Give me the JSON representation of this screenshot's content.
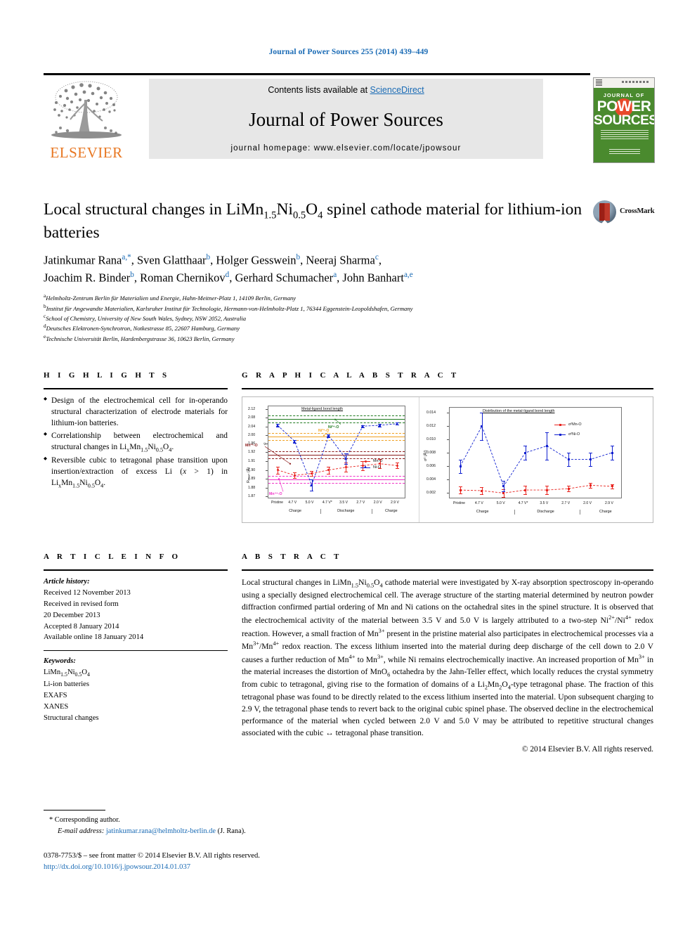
{
  "runhead": "Journal of Power Sources 255 (2014) 439–449",
  "masthead": {
    "contents_prefix": "Contents lists available at ",
    "sciencedirect": "ScienceDirect",
    "journal_title": "Journal of Power Sources",
    "homepage": "journal homepage: www.elsevier.com/locate/jpowsour",
    "publisher_wordmark": "ELSEVIER",
    "cover": {
      "line1": "JOURNAL OF",
      "line2": "POWER",
      "line3": "SOURCES"
    }
  },
  "article": {
    "title_part1": "Local structural changes in LiMn",
    "title_sub1": "1.5",
    "title_part2": "Ni",
    "title_sub2": "0.5",
    "title_part3": "O",
    "title_sub3": "4",
    "title_part4": " spinel cathode material for lithium-ion batteries",
    "crossmark_label": "CrossMark",
    "authors_line1": "Jatinkumar Rana a,*, Sven Glatthaar b, Holger Gesswein b, Neeraj Sharma c,",
    "authors_line2": "Joachim R. Binder b, Roman Chernikov d, Gerhard Schumacher a, John Banhart a,e",
    "affiliations": [
      {
        "mark": "a",
        "text": "Helmholtz-Zentrum Berlin für Materialien und Energie, Hahn-Meitner-Platz 1, 14109 Berlin, Germany"
      },
      {
        "mark": "b",
        "text": "Institut für Angewandte Materialien, Karlsruher Institut für Technologie, Hermann-von-Helmholtz-Platz 1, 76344 Eggenstein-Leopoldshafen, Germany"
      },
      {
        "mark": "c",
        "text": "School of Chemistry, University of New South Wales, Sydney, NSW 2052, Australia"
      },
      {
        "mark": "d",
        "text": "Deutsches Elektronen-Synchrotron, Notkestrasse 85, 22607 Hamburg, Germany"
      },
      {
        "mark": "e",
        "text": "Technische Universität Berlin, Hardenbergstrasse 36, 10623 Berlin, Germany"
      }
    ]
  },
  "highlights": {
    "heading": "H I G H L I G H T S",
    "items": [
      "Design of the electrochemical cell for in-operando structural characterization of electrode materials for lithium-ion batteries.",
      "Correlationship between electrochemical and structural changes in LixMn1.5Ni0.5O4.",
      "Reversible cubic to tetragonal phase transition upon insertion/extraction of excess Li (x > 1) in LixMn1.5Ni0.5O4."
    ]
  },
  "graphical_abstract": {
    "heading": "G R A P H I C A L   A B S T R A C T"
  },
  "article_info": {
    "heading": "A R T I C L E   I N F O",
    "history_label": "Article history:",
    "history": [
      "Received 12 November 2013",
      "Received in revised form",
      "20 December 2013",
      "Accepted 8 January 2014",
      "Available online 18 January 2014"
    ],
    "keywords_label": "Keywords:",
    "keywords": [
      "LiMn1.5Ni0.5O4",
      "Li-ion batteries",
      "EXAFS",
      "XANES",
      "Structural changes"
    ]
  },
  "abstract": {
    "heading": "A B S T R A C T",
    "body": "Local structural changes in LiMn1.5Ni0.5O4 cathode material were investigated by X-ray absorption spectroscopy in-operando using a specially designed electrochemical cell. The average structure of the starting material determined by neutron powder diffraction confirmed partial ordering of Mn and Ni cations on the octahedral sites in the spinel structure. It is observed that the electrochemical activity of the material between 3.5 V and 5.0 V is largely attributed to a two-step Ni2+/Ni4+ redox reaction. However, a small fraction of Mn3+ present in the pristine material also participates in electrochemical processes via a Mn3+/Mn4+ redox reaction. The excess lithium inserted into the material during deep discharge of the cell down to 2.0 V causes a further reduction of Mn4+ to Mn3+, while Ni remains electrochemically inactive. An increased proportion of Mn3+ in the material increases the distortion of MnO6 octahedra by the Jahn-Teller effect, which locally reduces the crystal symmetry from cubic to tetragonal, giving rise to the formation of domains of a Li2Mn2O4-type tetragonal phase. The fraction of this tetragonal phase was found to be directly related to the excess lithium inserted into the material. Upon subsequent charging to 2.9 V, the tetragonal phase tends to revert back to the original cubic spinel phase. The observed decline in the electrochemical performance of the material when cycled between 2.0 V and 5.0 V may be attributed to repetitive structural changes associated with the cubic ↔ tetragonal phase transition.",
    "copyright": "© 2014 Elsevier B.V. All rights reserved."
  },
  "footer": {
    "corresponding": "* Corresponding author.",
    "email_label": "E-mail address:",
    "email": "jatinkumar.rana@helmholtz-berlin.de",
    "email_suffix": "(J. Rana).",
    "issn_line": "0378-7753/$ – see front matter © 2014 Elsevier B.V. All rights reserved.",
    "doi": "http://dx.doi.org/10.1016/j.jpowsour.2014.01.037"
  },
  "chart_data": [
    {
      "id": "bond-length",
      "type": "line",
      "title": "Metal-ligand bond length",
      "ylabel": "R_mean (Å)",
      "xlabel": "",
      "categories": [
        "Pristine",
        "4.7 V",
        "5.0 V",
        "4.7 V*",
        "3.5 V",
        "2.7 V",
        "2.0 V",
        "2.9 V"
      ],
      "stage_labels": [
        "Charge",
        "Discharge",
        "Charge"
      ],
      "axis_break": true,
      "yticks_upper": [
        "2.12",
        "2.08",
        "2.04",
        "2.00",
        "1.96"
      ],
      "yticks_lower": [
        "1.92",
        "1.91",
        "1.90",
        "1.89",
        "1.88",
        "1.87"
      ],
      "ylim_upper": [
        1.955,
        2.135
      ],
      "ylim_lower": [
        1.868,
        1.925
      ],
      "series": [
        {
          "name": "Mn-O",
          "color": "#e8241f",
          "marker": "circle",
          "values": [
            1.9,
            1.894,
            1.896,
            1.9,
            1.903,
            1.905,
            1.907,
            1.905
          ],
          "errors": [
            0.004,
            0.003,
            0.003,
            0.004,
            0.005,
            0.005,
            0.005,
            0.003
          ]
        },
        {
          "name": "Ni-O",
          "color": "#1020d0",
          "marker": "triangle",
          "values": [
            2.045,
            1.972,
            1.883,
            1.997,
            1.913,
            2.041,
            2.045,
            2.052
          ],
          "errors": [
            0.005,
            0.006,
            0.006,
            0.006,
            0.006,
            0.005,
            0.005,
            0.005
          ]
        }
      ],
      "reference_lines": [
        {
          "label": "Ni2+-O",
          "color": "#1f7a1f",
          "value": 2.075
        },
        {
          "label": "Ni3+-O",
          "color": "#f0a020",
          "value": 1.995
        },
        {
          "label": "Mn3+-O",
          "color": "#8b1a1a",
          "value": 1.917
        },
        {
          "label": "Mn4+-O",
          "color": "#f030c8",
          "value": 1.889
        }
      ],
      "legend": [
        "Mn-O",
        "Ni-O"
      ],
      "legend_position": "right-middle"
    },
    {
      "id": "bond-length-distribution",
      "type": "line",
      "title": "Distribution of the metal-ligand bond length",
      "ylabel": "σ² (Å²)",
      "xlabel": "",
      "categories": [
        "Pristine",
        "4.7 V",
        "5.0 V",
        "4.7 V*",
        "3.5 V",
        "2.7 V",
        "2.0 V",
        "2.9 V"
      ],
      "stage_labels": [
        "Charge",
        "Discharge",
        "Charge"
      ],
      "yticks": [
        "0.014",
        "0.012",
        "0.010",
        "0.008",
        "0.006",
        "0.004",
        "0.002"
      ],
      "ylim": [
        0.0012,
        0.0148
      ],
      "series": [
        {
          "name": "σ² Mn-O",
          "color": "#e8241f",
          "marker": "square",
          "values": [
            0.00245,
            0.00235,
            0.002,
            0.00245,
            0.00245,
            0.00265,
            0.00315,
            0.003
          ],
          "errors": [
            0.00055,
            0.0005,
            0.00055,
            0.0006,
            0.0006,
            0.00045,
            0.00035,
            0.0003
          ]
        },
        {
          "name": "σ² Ni-O",
          "color": "#1020d0",
          "marker": "square",
          "values": [
            0.006,
            0.01195,
            0.003,
            0.008,
            0.009,
            0.007,
            0.007,
            0.008
          ],
          "errors": [
            0.001,
            0.00205,
            0.0008,
            0.001,
            0.002,
            0.001,
            0.001,
            0.001
          ]
        }
      ],
      "legend": [
        "σ²Mn-O",
        "σ²Ni-O"
      ],
      "legend_position": "top-right"
    }
  ]
}
